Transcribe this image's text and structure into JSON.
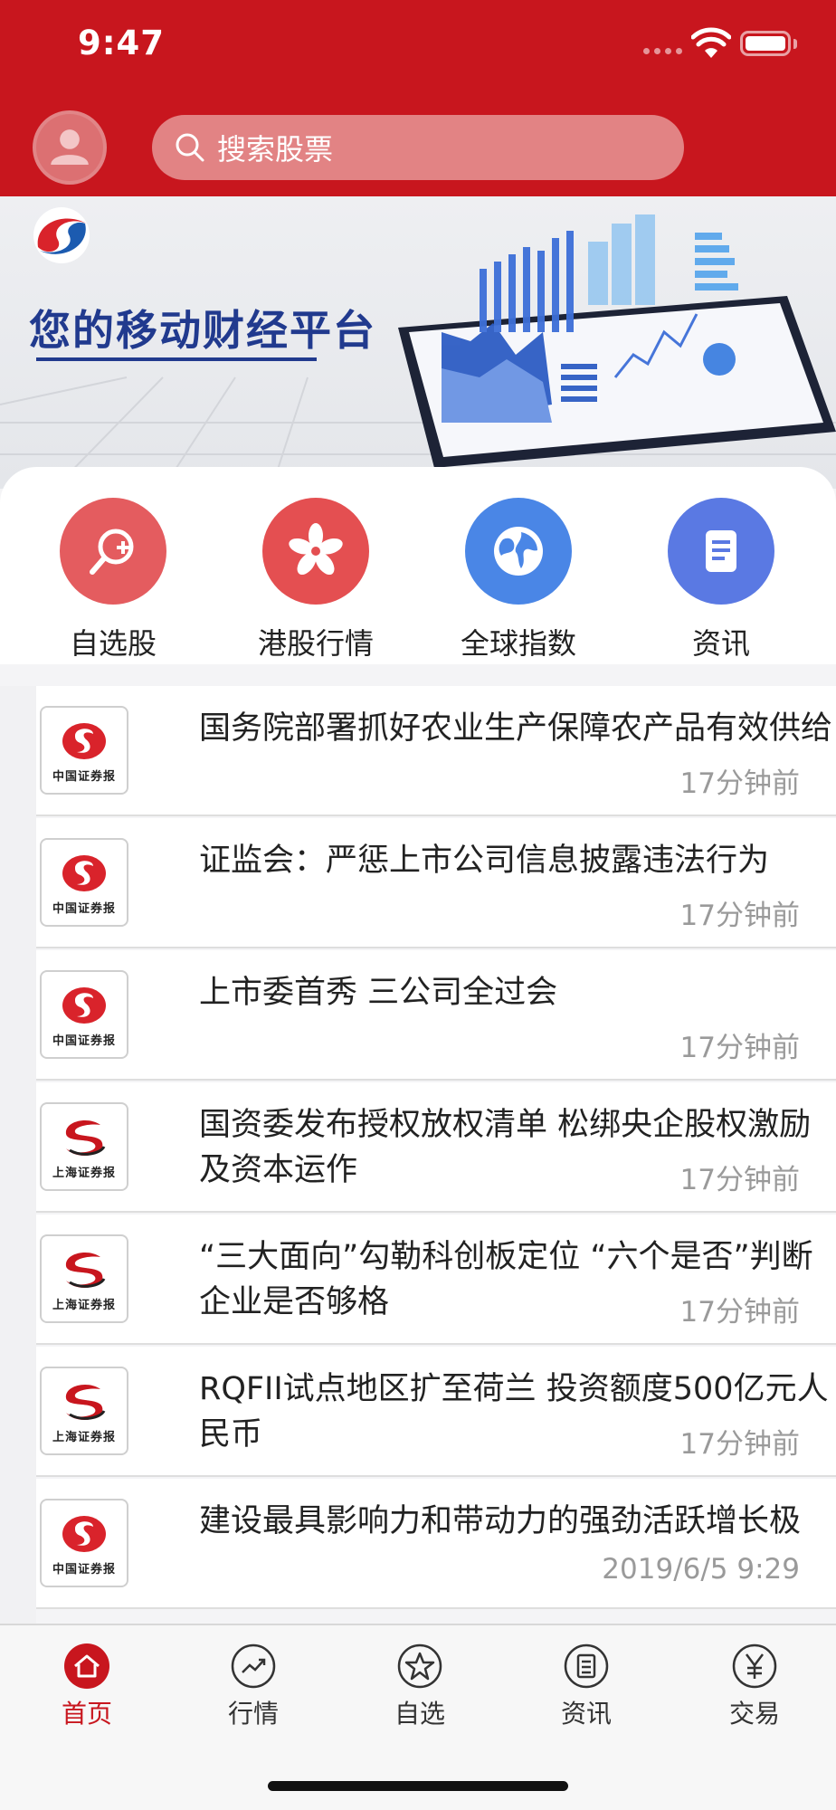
{
  "status_bar": {
    "time": "9:47"
  },
  "header": {
    "search_placeholder": "搜索股票",
    "avatar_icon": "user-avatar-icon",
    "search_icon": "search-icon"
  },
  "banner": {
    "title": "您的移动财经平台"
  },
  "quick_nav": [
    {
      "label": "自选股",
      "icon": "stock-search-plus-icon",
      "color": "#e45c5f"
    },
    {
      "label": "港股行情",
      "icon": "hong-kong-flower-icon",
      "color": "#e44f51"
    },
    {
      "label": "全球指数",
      "icon": "globe-icon",
      "color": "#4a86e6"
    },
    {
      "label": "资讯",
      "icon": "document-icon",
      "color": "#5a79e3"
    }
  ],
  "news": [
    {
      "title": "国务院部署抓好农业生产保障农产品有效供给",
      "time": "17分钟前",
      "source": "中国证券报"
    },
    {
      "title": "证监会：严惩上市公司信息披露违法行为",
      "time": "17分钟前",
      "source": "中国证券报"
    },
    {
      "title": "上市委首秀 三公司全过会",
      "time": "17分钟前",
      "source": "中国证券报"
    },
    {
      "title": "国资委发布授权放权清单 松绑央企股权激励及资本运作",
      "time": "17分钟前",
      "source": "上海证券报"
    },
    {
      "title": "“三大面向”勾勒科创板定位 “六个是否”判断企业是否够格",
      "time": "17分钟前",
      "source": "上海证券报"
    },
    {
      "title": "RQFII试点地区扩至荷兰 投资额度500亿元人民币",
      "time": "17分钟前",
      "source": "上海证券报"
    },
    {
      "title": "建设最具影响力和带动力的强劲活跃增长极",
      "time": "2019/6/5 9:29",
      "source": "中国证券报"
    }
  ],
  "tabbar": [
    {
      "label": "首页",
      "icon": "home-icon",
      "active": true
    },
    {
      "label": "行情",
      "icon": "market-trend-icon",
      "active": false
    },
    {
      "label": "自选",
      "icon": "star-icon",
      "active": false
    },
    {
      "label": "资讯",
      "icon": "news-icon",
      "active": false
    },
    {
      "label": "交易",
      "icon": "yen-icon",
      "active": false
    }
  ],
  "colors": {
    "brand_red": "#c8161e",
    "banner_blue": "#213a8e",
    "time_gray": "#9a9a9a"
  }
}
